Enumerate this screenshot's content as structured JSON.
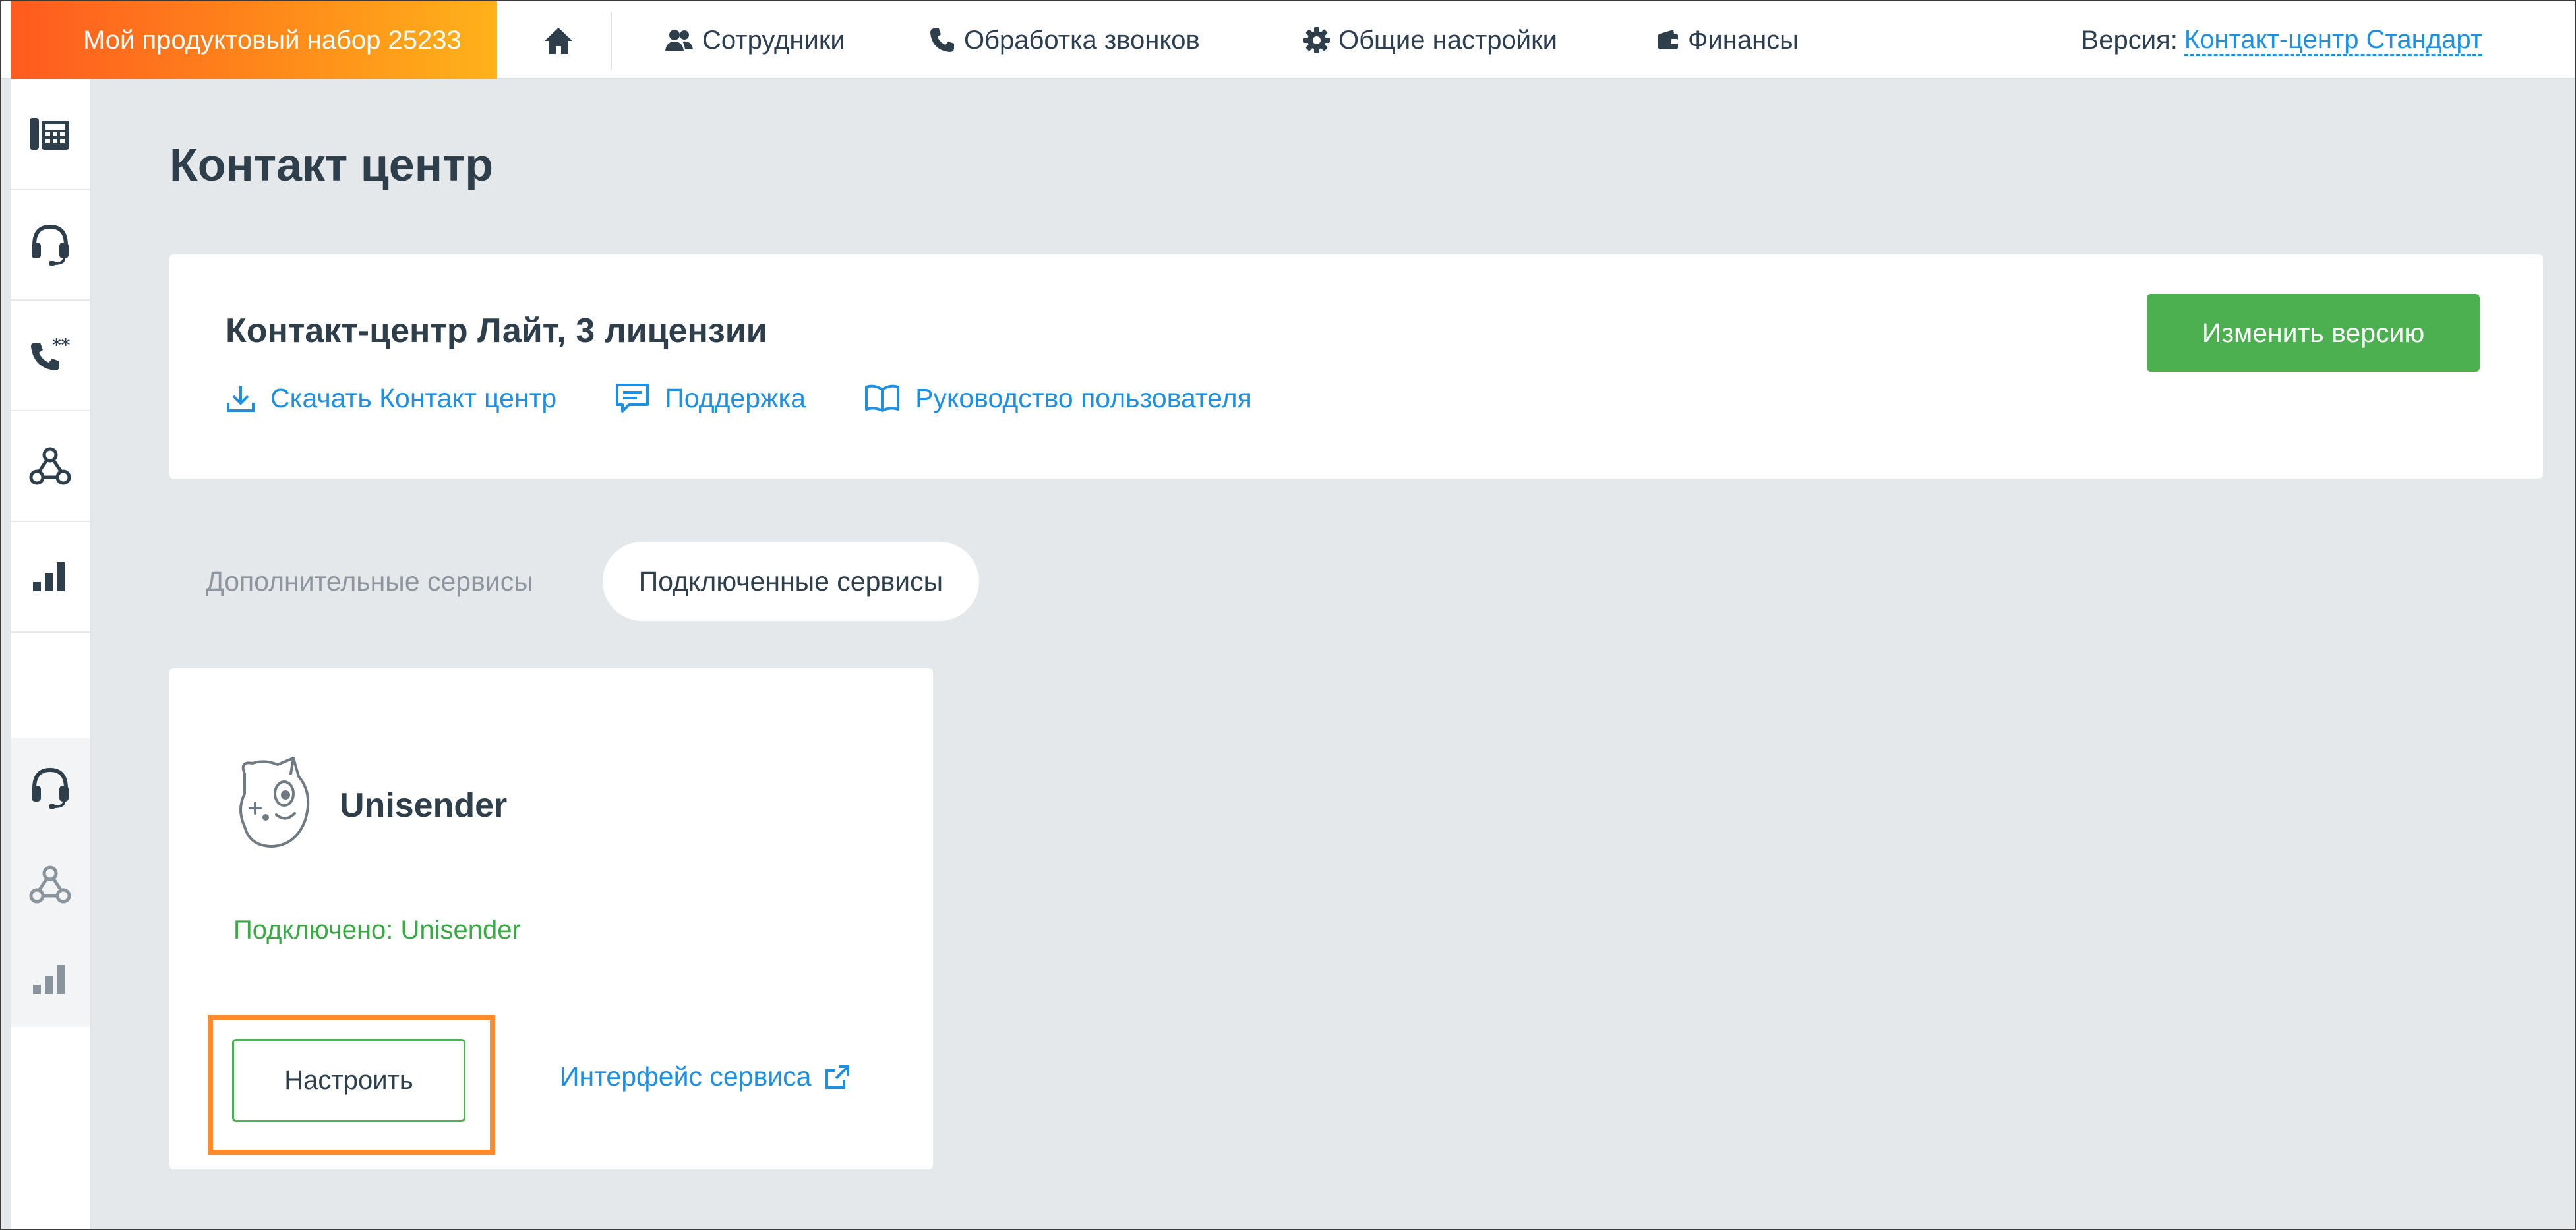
{
  "topbar": {
    "product_label": "Мой продуктовый набор 25233",
    "nav": [
      {
        "label": "Сотрудники",
        "icon": "users-icon"
      },
      {
        "label": "Обработка звонков",
        "icon": "phone-icon"
      },
      {
        "label": "Общие настройки",
        "icon": "gear-icon"
      },
      {
        "label": "Финансы",
        "icon": "wallet-icon"
      }
    ],
    "version_label": "Версия:",
    "version_value": "Контакт-центр Стандарт"
  },
  "sidebar": {
    "items": [
      {
        "icon": "phone-keypad-icon"
      },
      {
        "icon": "headset-icon"
      },
      {
        "icon": "phone-stars-icon"
      },
      {
        "icon": "webhook-icon"
      },
      {
        "icon": "bar-chart-icon"
      },
      {
        "icon": "headset-icon"
      },
      {
        "icon": "webhook-icon"
      },
      {
        "icon": "bar-chart-icon"
      }
    ]
  },
  "main": {
    "page_title": "Контакт центр",
    "license_card": {
      "title": "Контакт-центр Лайт, 3 лицензии",
      "change_version_button": "Изменить версию",
      "links": [
        {
          "label": "Скачать Контакт центр",
          "icon": "download-icon"
        },
        {
          "label": "Поддержка",
          "icon": "chat-icon"
        },
        {
          "label": "Руководство пользователя",
          "icon": "book-icon"
        }
      ]
    },
    "tabs": [
      {
        "label": "Дополнительные сервисы",
        "active": false
      },
      {
        "label": "Подключенные сервисы",
        "active": true
      }
    ],
    "service_card": {
      "name": "Unisender",
      "status": "Подключено: Unisender",
      "configure_button": "Настроить",
      "interface_link": "Интерфейс сервиса"
    }
  },
  "colors": {
    "accent_green": "#4caf50",
    "link_blue": "#1f8fe0",
    "status_green": "#3aa845",
    "highlight_orange": "#ff8a2b",
    "brand_gradient_start": "#ff5a1f",
    "brand_gradient_end": "#ffb21a"
  }
}
